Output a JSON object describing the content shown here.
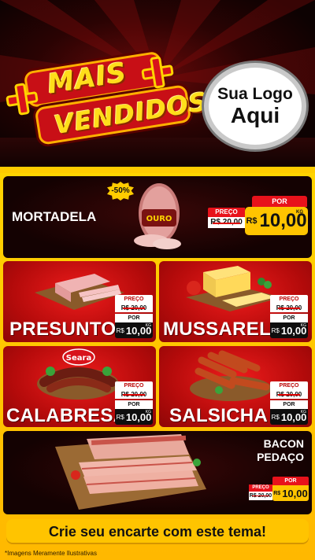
{
  "header": {
    "title_line1": "MAIS",
    "title_line2": "VENDIDOS",
    "logo_line1": "Sua Logo",
    "logo_line2": "Aqui"
  },
  "featured": {
    "name": "MORTADELA",
    "discount": "-50%",
    "brand_label": "OURO",
    "preco_label": "PREÇO",
    "old_price": "R$ 20,00",
    "por_label": "POR",
    "currency": "R$",
    "price": "10,00",
    "unit": "KG"
  },
  "products": [
    {
      "name": "PRESUNTO",
      "preco_label": "PREÇO",
      "old_price": "R$ 20,00",
      "por_label": "POR",
      "currency": "R$",
      "price": "10,00",
      "unit": "KG"
    },
    {
      "name": "MUSSARELA",
      "preco_label": "PREÇO",
      "old_price": "R$ 20,00",
      "por_label": "POR",
      "currency": "R$",
      "price": "10,00",
      "unit": "KG"
    },
    {
      "name": "CALABRESA",
      "brand_label": "Seara",
      "preco_label": "PREÇO",
      "old_price": "R$ 20,00",
      "por_label": "POR",
      "currency": "R$",
      "price": "10,00",
      "unit": "KG"
    },
    {
      "name": "SALSICHA",
      "preco_label": "PREÇO",
      "old_price": "R$ 20,00",
      "por_label": "POR",
      "currency": "R$",
      "price": "10,00",
      "unit": "KG"
    }
  ],
  "bacon": {
    "name_line1": "BACON",
    "name_line2": "PEDAÇO",
    "preco_label": "PREÇO",
    "old_price": "R$ 20,00",
    "por_label": "POR",
    "currency": "R$",
    "price": "10,00"
  },
  "cta": "Crie seu encarte com este tema!",
  "disclaimer": "*Imagens Meramente Ilustrativas",
  "colors": {
    "accent_red": "#e8121b",
    "accent_yellow": "#ffc400",
    "dark": "#140202"
  }
}
